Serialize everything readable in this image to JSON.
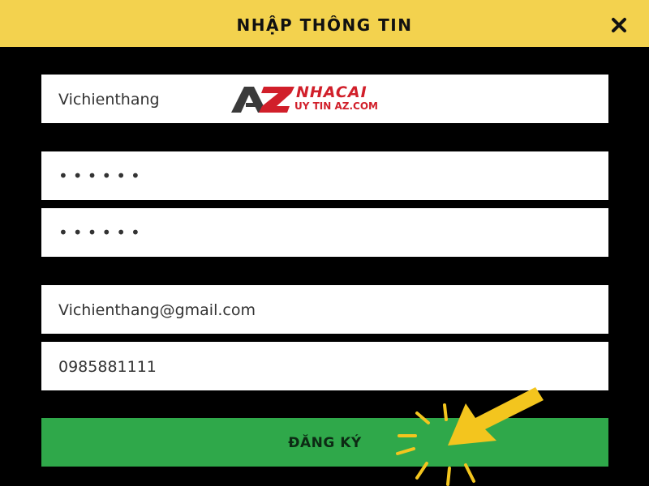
{
  "header": {
    "title": "NHẬP THÔNG TIN",
    "close_symbol": "✕",
    "close_icon": "close-icon",
    "background_color": "#f3d24e"
  },
  "form": {
    "username_value": "Vichienthang",
    "password_value": "••••••",
    "confirm_password_value": "••••••",
    "email_value": "Vichienthang@gmail.com",
    "phone_value": "0985881111"
  },
  "watermark": {
    "logo_mark": "AZ",
    "title": "NHACAI",
    "subtitle": "UY TIN AZ.COM",
    "color": "#d11f2a"
  },
  "register_button": {
    "label": "ĐĂNG KÝ",
    "color": "#2fa84a"
  },
  "overlay": {
    "icon": "pointer-arrow-icon",
    "color": "#f3c51e"
  }
}
